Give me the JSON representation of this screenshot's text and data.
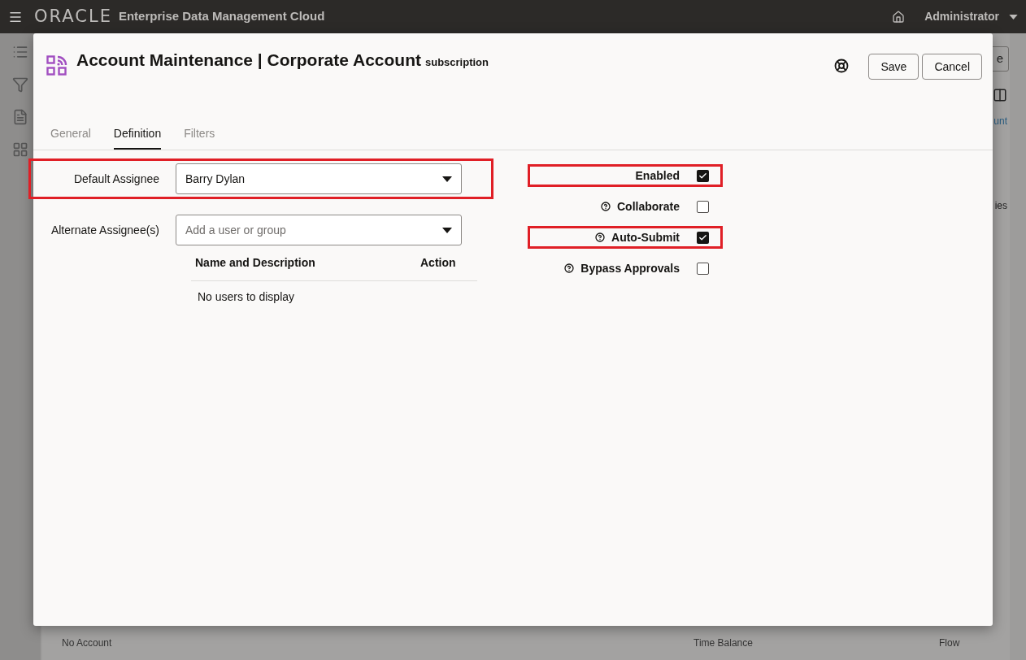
{
  "header": {
    "logo": "ORACLE",
    "app_title": "Enterprise Data Management Cloud",
    "user": "Administrator"
  },
  "background": {
    "button_fragment": "e",
    "link_fragment": "unt",
    "text_fragment": "ies",
    "bottom_row": [
      "No Account",
      "Time Balance",
      "Flow"
    ]
  },
  "dialog": {
    "title": "Account Maintenance | Corporate Account",
    "subtitle": "subscription",
    "buttons": [
      "Save",
      "Cancel"
    ],
    "tabs": [
      {
        "label": "General",
        "selected": false
      },
      {
        "label": "Definition",
        "selected": true
      },
      {
        "label": "Filters",
        "selected": false
      }
    ],
    "default_assignee": {
      "label": "Default Assignee",
      "value": "Barry Dylan",
      "highlighted": true
    },
    "alternate_assignees": {
      "label": "Alternate Assignee(s)",
      "placeholder": "Add a user or group",
      "columns": [
        "Name and Description",
        "Action"
      ],
      "empty_message": "No users to display"
    },
    "options": [
      {
        "label": "Enabled",
        "help": false,
        "checked": true,
        "highlighted": true
      },
      {
        "label": "Collaborate",
        "help": true,
        "checked": false,
        "highlighted": false
      },
      {
        "label": "Auto-Submit",
        "help": true,
        "checked": true,
        "highlighted": true
      },
      {
        "label": "Bypass Approvals",
        "help": true,
        "checked": false,
        "highlighted": false
      }
    ]
  }
}
